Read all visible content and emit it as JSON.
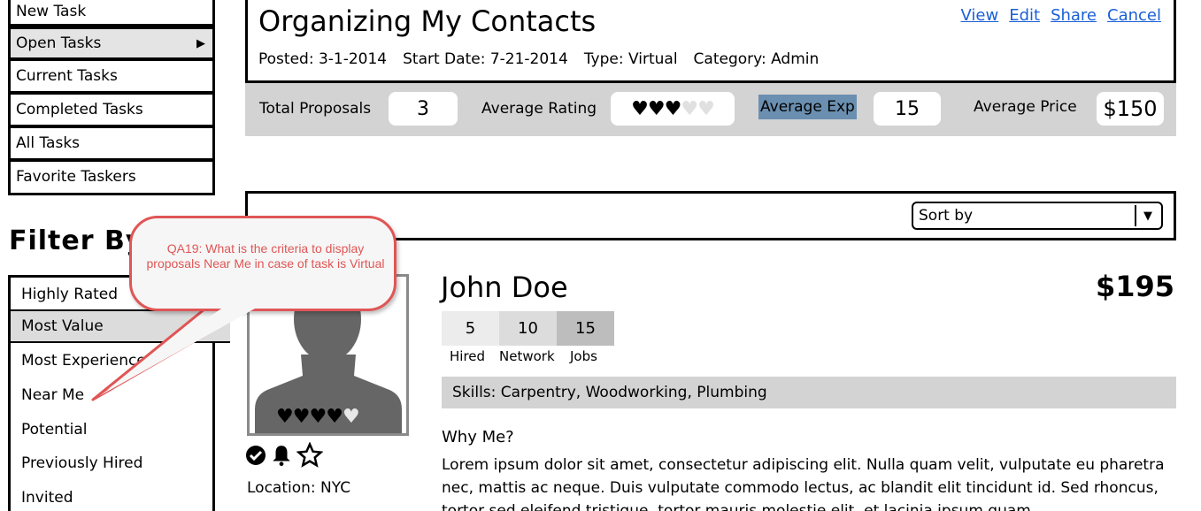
{
  "nav": {
    "items": [
      {
        "label": "New Task"
      },
      {
        "label": "Open Tasks",
        "arrow": "▶"
      },
      {
        "label": "Current Tasks"
      },
      {
        "label": "Completed Tasks"
      },
      {
        "label": "All Tasks"
      },
      {
        "label": "Favorite Taskers"
      }
    ]
  },
  "filter": {
    "title": "Filter By",
    "items": [
      {
        "label": "Highly Rated"
      },
      {
        "label": "Most Value"
      },
      {
        "label": "Most Experienced"
      },
      {
        "label": "Near Me"
      },
      {
        "label": "Potential"
      },
      {
        "label": "Previously Hired"
      },
      {
        "label": "Invited"
      }
    ]
  },
  "task": {
    "title": "Organizing My Contacts",
    "posted": "Posted: 3-1-2014",
    "start_date": "Start Date: 7-21-2014",
    "type": "Type: Virtual",
    "category": "Category: Admin",
    "actions": {
      "view": "View",
      "edit": "Edit",
      "share": "Share",
      "cancel": "Cancel"
    }
  },
  "stats": {
    "total_proposals_label": "Total Proposals",
    "total_proposals_value": "3",
    "average_rating_label": "Average Rating",
    "average_rating_hearts": 3,
    "average_rating_max": 5,
    "average_exp_label": "Average Exp",
    "average_exp_value": "15",
    "average_price_label": "Average Price",
    "average_price_value": "$150"
  },
  "sort": {
    "label": "Sort by",
    "arrow": "▼"
  },
  "proposal": {
    "name": "John Doe",
    "price": "$195",
    "rating_hearts": 4,
    "rating_max": 5,
    "counters": [
      {
        "value": "5",
        "label": "Hired"
      },
      {
        "value": "10",
        "label": "Network"
      },
      {
        "value": "15",
        "label": "Jobs"
      }
    ],
    "skills": "Skills: Carpentry, Woodworking, Plumbing",
    "location": "Location: NYC",
    "why_title": "Why Me?",
    "why_body": "Lorem ipsum dolor sit amet, consectetur adipiscing elit. Nulla quam velit, vulputate eu pharetra nec, mattis ac neque. Duis vulputate commodo lectus, ac blandit elit tincidunt id. Sed rhoncus, tortor sed eleifend tristique, tortor mauris molestie elit, et lacinia ipsum quam"
  },
  "callout": {
    "text": "QA19: What is the criteria to display proposals Near Me in case of task is Virtual"
  },
  "colors": {
    "link": "#1a5fd6",
    "callout_border": "#e05555",
    "highlight": "#6a8fb0",
    "bar_gray": "#d3d3d3"
  }
}
